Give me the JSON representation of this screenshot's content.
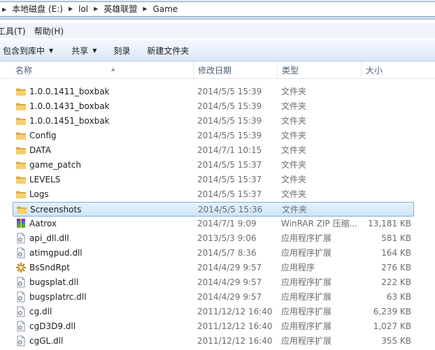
{
  "address": {
    "crumbs": [
      "本地磁盘 (E:)",
      "lol",
      "英雄联盟",
      "Game"
    ]
  },
  "menu": {
    "tools": "工具(T)",
    "help": "帮助(H)"
  },
  "toolbar": {
    "include_library": "包含到库中",
    "share": "共享",
    "burn": "刻录",
    "new_folder": "新建文件夹"
  },
  "columns": {
    "name": "名称",
    "date": "修改日期",
    "type": "类型",
    "size": "大小"
  },
  "files": [
    {
      "name": "1.0.0.1411_boxbak",
      "date": "2014/5/5 15:39",
      "type": "文件夹",
      "size": "",
      "icon": "folder-icon"
    },
    {
      "name": "1.0.0.1431_boxbak",
      "date": "2014/5/5 15:39",
      "type": "文件夹",
      "size": "",
      "icon": "folder-icon"
    },
    {
      "name": "1.0.0.1451_boxbak",
      "date": "2014/5/5 15:39",
      "type": "文件夹",
      "size": "",
      "icon": "folder-icon"
    },
    {
      "name": "Config",
      "date": "2014/5/5 15:39",
      "type": "文件夹",
      "size": "",
      "icon": "folder-icon"
    },
    {
      "name": "DATA",
      "date": "2014/7/1 10:15",
      "type": "文件夹",
      "size": "",
      "icon": "folder-icon"
    },
    {
      "name": "game_patch",
      "date": "2014/5/5 15:37",
      "type": "文件夹",
      "size": "",
      "icon": "folder-icon"
    },
    {
      "name": "LEVELS",
      "date": "2014/5/5 15:37",
      "type": "文件夹",
      "size": "",
      "icon": "folder-icon"
    },
    {
      "name": "Logs",
      "date": "2014/5/5 15:37",
      "type": "文件夹",
      "size": "",
      "icon": "folder-icon"
    },
    {
      "name": "Screenshots",
      "date": "2014/5/5 15:36",
      "type": "文件夹",
      "size": "",
      "icon": "folder-icon",
      "selected": true
    },
    {
      "name": "Aatrox",
      "date": "2014/7/1 9:09",
      "type": "WinRAR ZIP 压缩...",
      "size": "13,181 KB",
      "icon": "winrar-archive-icon"
    },
    {
      "name": "api_dll.dll",
      "date": "2013/5/3 9:06",
      "type": "应用程序扩展",
      "size": "581 KB",
      "icon": "dll-file-icon"
    },
    {
      "name": "atimgpud.dll",
      "date": "2014/5/7 8:36",
      "type": "应用程序扩展",
      "size": "164 KB",
      "icon": "dll-file-icon"
    },
    {
      "name": "BsSndRpt",
      "date": "2014/4/29 9:57",
      "type": "应用程序",
      "size": "276 KB",
      "icon": "application-icon"
    },
    {
      "name": "bugsplat.dll",
      "date": "2014/4/29 9:57",
      "type": "应用程序扩展",
      "size": "222 KB",
      "icon": "dll-file-icon"
    },
    {
      "name": "bugsplatrc.dll",
      "date": "2014/4/29 9:57",
      "type": "应用程序扩展",
      "size": "63 KB",
      "icon": "dll-file-icon"
    },
    {
      "name": "cg.dll",
      "date": "2011/12/12 16:40",
      "type": "应用程序扩展",
      "size": "6,239 KB",
      "icon": "dll-file-icon"
    },
    {
      "name": "cgD3D9.dll",
      "date": "2011/12/12 16:40",
      "type": "应用程序扩展",
      "size": "1,027 KB",
      "icon": "dll-file-icon"
    },
    {
      "name": "cgGL.dll",
      "date": "2011/12/12 16:40",
      "type": "应用程序扩展",
      "size": "355 KB",
      "icon": "dll-file-icon"
    }
  ]
}
